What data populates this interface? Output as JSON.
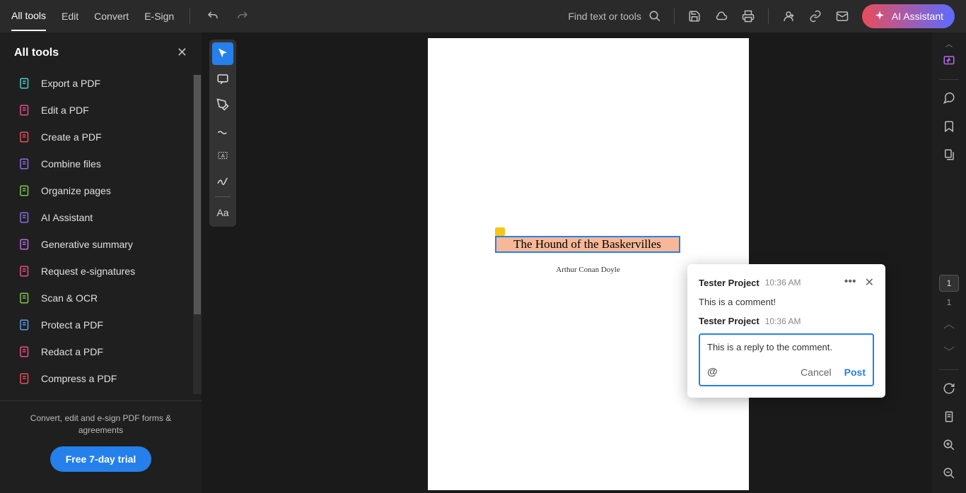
{
  "topMenu": {
    "items": [
      "All tools",
      "Edit",
      "Convert",
      "E-Sign"
    ],
    "searchPlaceholder": "Find text or tools",
    "aiButton": "AI Assistant"
  },
  "sidebar": {
    "title": "All tools",
    "items": [
      {
        "label": "Export a PDF",
        "color": "#4ecdc4"
      },
      {
        "label": "Edit a PDF",
        "color": "#e84d8b"
      },
      {
        "label": "Create a PDF",
        "color": "#e84d5b"
      },
      {
        "label": "Combine files",
        "color": "#8b6ce8"
      },
      {
        "label": "Organize pages",
        "color": "#7bc950"
      },
      {
        "label": "AI Assistant",
        "color": "#8b6ce8"
      },
      {
        "label": "Generative summary",
        "color": "#b56ce8"
      },
      {
        "label": "Request e-signatures",
        "color": "#e84d8b"
      },
      {
        "label": "Scan & OCR",
        "color": "#7bc950"
      },
      {
        "label": "Protect a PDF",
        "color": "#5c9ce8"
      },
      {
        "label": "Redact a PDF",
        "color": "#e84d8b"
      },
      {
        "label": "Compress a PDF",
        "color": "#e84d5b"
      }
    ],
    "footerText": "Convert, edit and e-sign PDF forms & agreements",
    "trialButton": "Free 7-day trial"
  },
  "document": {
    "title": "The Hound of the Baskervilles",
    "author": "Arthur Conan Doyle"
  },
  "comment": {
    "author1": "Tester Project",
    "time1": "10:36 AM",
    "text1": "This is a comment!",
    "author2": "Tester Project",
    "time2": "10:36 AM",
    "replyText": "This is a reply to the comment.",
    "cancelLabel": "Cancel",
    "postLabel": "Post"
  },
  "pageNav": {
    "current": "1",
    "total": "1"
  }
}
